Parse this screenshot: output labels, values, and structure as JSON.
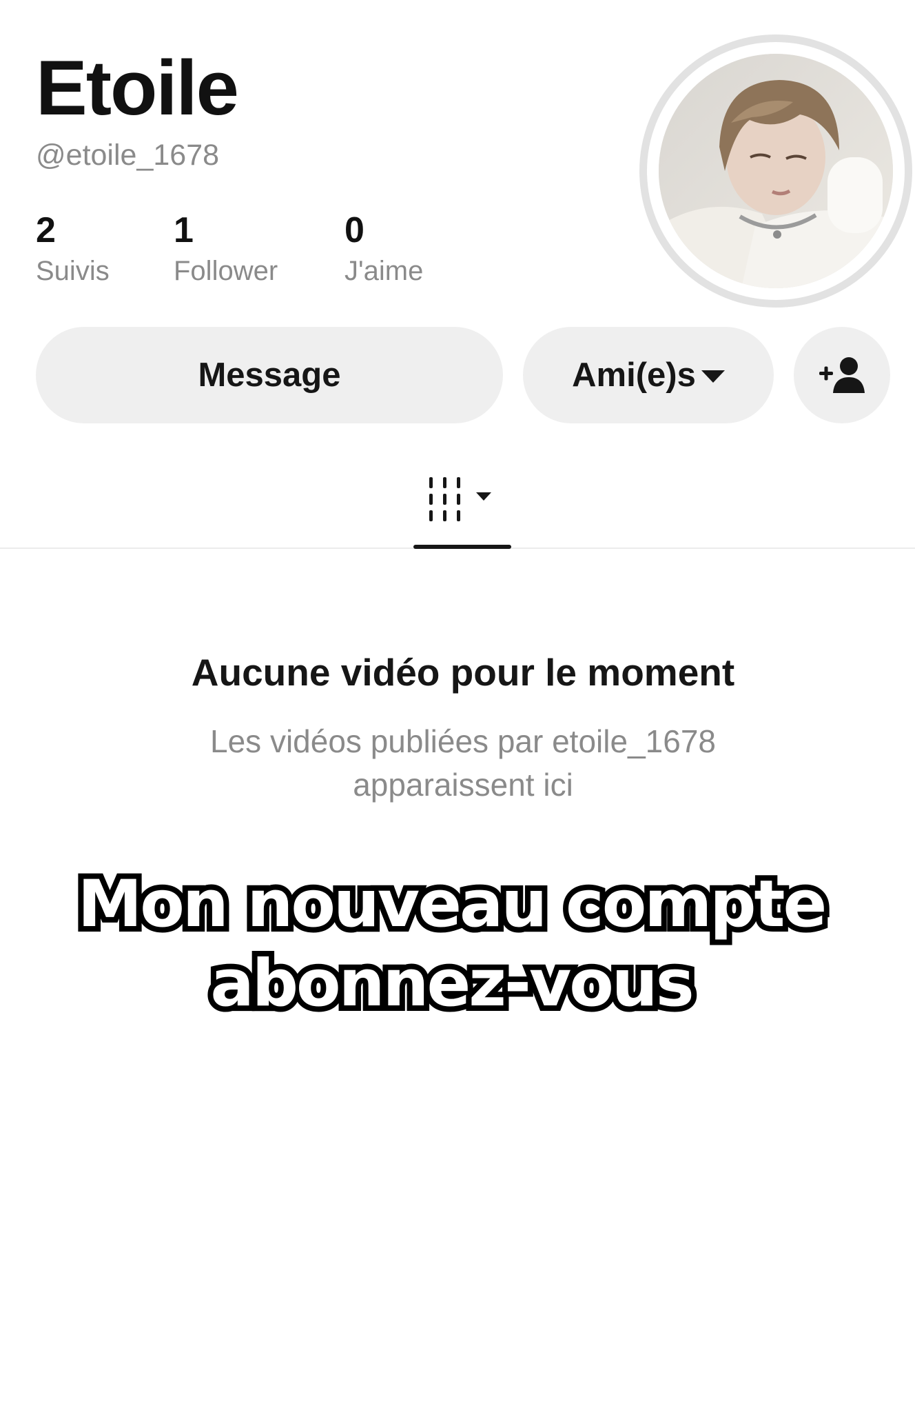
{
  "profile": {
    "display_name": "Etoile",
    "username": "@etoile_1678",
    "avatar_icon": "profile-photo"
  },
  "stats": [
    {
      "value": "2",
      "label": "Suivis"
    },
    {
      "value": "1",
      "label": "Follower"
    },
    {
      "value": "0",
      "label": "J'aime"
    }
  ],
  "actions": {
    "message_label": "Message",
    "friends_label": "Ami(e)s",
    "friends_icon": "caret-down-icon",
    "add_friend_icon": "add-person-icon"
  },
  "tabs": {
    "videos_icon": "grid-icon",
    "videos_dropdown_icon": "caret-down-icon",
    "selected": "videos"
  },
  "empty_state": {
    "title": "Aucune vidéo pour le moment",
    "subtitle_line1": "Les vidéos publiées par etoile_1678",
    "subtitle_line2": "apparaissent ici"
  },
  "overlay": {
    "line1": "Mon nouveau compte",
    "line2": "abonnez-vous"
  },
  "colors": {
    "text": "#161616",
    "muted": "#8a8a8a",
    "button_bg": "#efefef",
    "avatar_ring": "#e2e2e2"
  }
}
